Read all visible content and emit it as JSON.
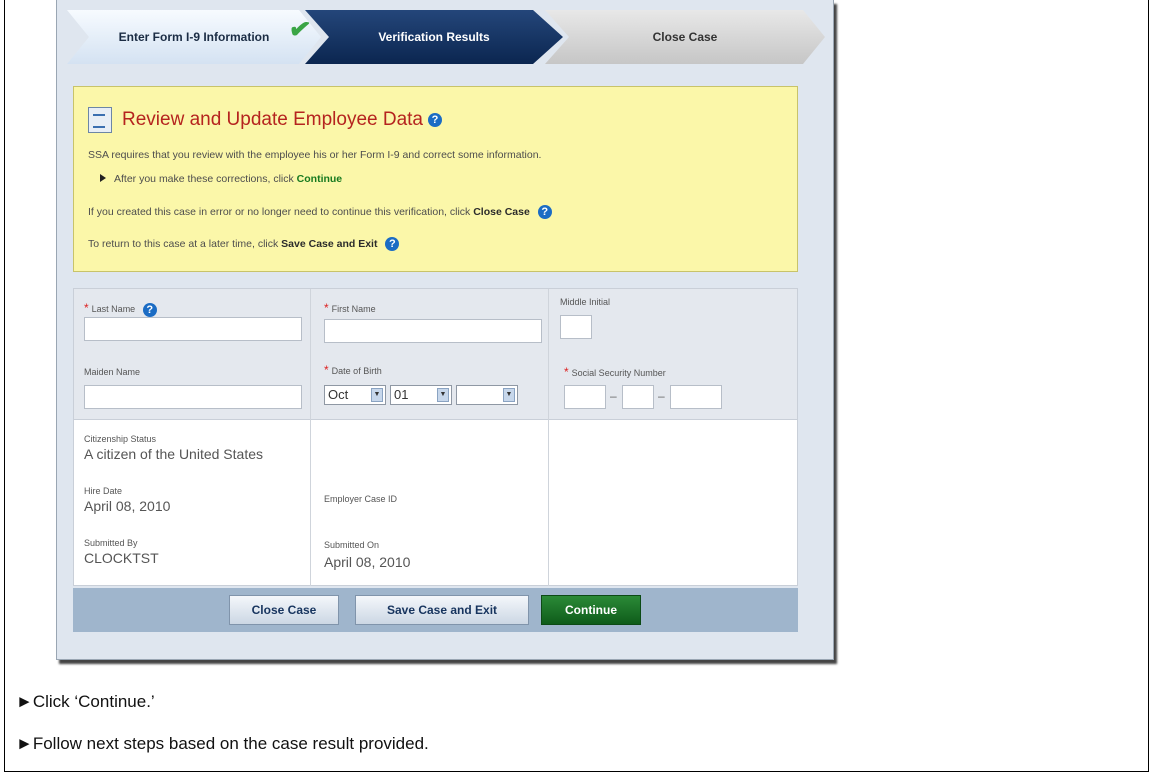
{
  "steps": {
    "step1": "Enter Form I-9 Information",
    "step2": "Verification Results",
    "step3": "Close Case"
  },
  "review": {
    "title": "Review and Update Employee Data",
    "line1": "SSA requires that you review with the employee his or her Form I-9 and correct some information.",
    "bullet_text": "After you make these corrections, click ",
    "bullet_link": "Continue",
    "line3_text": "If you created this case in error or no longer need to continue this verification, click ",
    "line3_link": "Close Case",
    "line4_text": "To return to this case at a later time, click ",
    "line4_link": "Save Case and Exit"
  },
  "form": {
    "last_name_label": "Last Name",
    "first_name_label": "First Name",
    "middle_initial_label": "Middle Initial",
    "maiden_name_label": "Maiden Name",
    "dob_label": "Date of Birth",
    "dob_month": "Oct",
    "dob_day": "01",
    "dob_year": "",
    "ssn_label": "Social Security Number",
    "citizenship_label": "Citizenship Status",
    "citizenship_value": "A citizen of the United States",
    "hire_date_label": "Hire Date",
    "hire_date_value": "April 08, 2010",
    "employer_case_id_label": "Employer Case ID",
    "submitted_by_label": "Submitted By",
    "submitted_by_value": "CLOCKTST",
    "submitted_on_label": "Submitted On",
    "submitted_on_value": "April 08, 2010"
  },
  "buttons": {
    "close_case": "Close Case",
    "save_exit": "Save Case and Exit",
    "continue": "Continue"
  },
  "instructions": {
    "line1": "►Click ‘Continue.’",
    "line2": "►Follow next steps based on the case result provided."
  },
  "colors": {
    "accent_red": "#b5241f",
    "continue_green": "#177a1f",
    "nav_blue": "#0b2650"
  }
}
